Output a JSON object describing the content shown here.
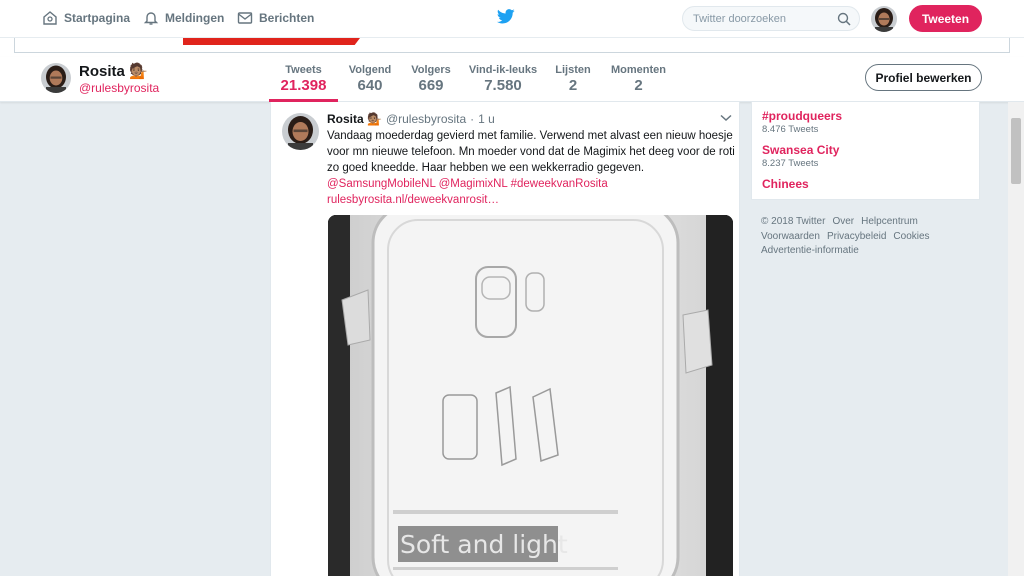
{
  "nav": {
    "home": "Startpagina",
    "notifications": "Meldingen",
    "messages": "Berichten"
  },
  "search": {
    "placeholder": "Twitter doorzoeken"
  },
  "tweet_button": "Tweeten",
  "profile": {
    "name": "Rosita 💁🏽",
    "handle": "@rulesbyrosita",
    "edit_button": "Profiel bewerken",
    "stats": [
      {
        "label": "Tweets",
        "value": "21.398"
      },
      {
        "label": "Volgend",
        "value": "640"
      },
      {
        "label": "Volgers",
        "value": "669"
      },
      {
        "label": "Vind-ik-leuks",
        "value": "7.580"
      },
      {
        "label": "Lijsten",
        "value": "2"
      },
      {
        "label": "Momenten",
        "value": "2"
      }
    ]
  },
  "tweet": {
    "name": "Rosita 💁🏽",
    "handle": "@rulesbyrosita",
    "dot": "·",
    "time": "1 u",
    "text": "Vandaag moederdag gevierd met familie. Verwend met alvast een nieuw hoesje voor mn nieuwe telefoon. Mn moeder vond dat de Magimix het deeg voor de roti zo goed kneedde. Haar hebben we een wekkerradio gegeven.",
    "links": [
      "@SamsungMobileNL",
      "@MagimixNL",
      "#deweekvanRosita"
    ],
    "url": "rulesbyrosita.nl/deweekvanrosit…",
    "media_text": "Soft and light"
  },
  "trends": [
    {
      "name": "#proudqueers",
      "count": "8.476 Tweets"
    },
    {
      "name": "Swansea City",
      "count": "8.237 Tweets"
    },
    {
      "name": "Chinees",
      "count": ""
    }
  ],
  "footer": {
    "line1": [
      "© 2018 Twitter",
      "Over",
      "Helpcentrum"
    ],
    "line2": [
      "Voorwaarden",
      "Privacybeleid",
      "Cookies"
    ],
    "line3": [
      "Advertentie-informatie"
    ]
  },
  "colors": {
    "accent": "#e0245e",
    "twitter_blue": "#1da1f2",
    "background": "#e6ecf0"
  }
}
